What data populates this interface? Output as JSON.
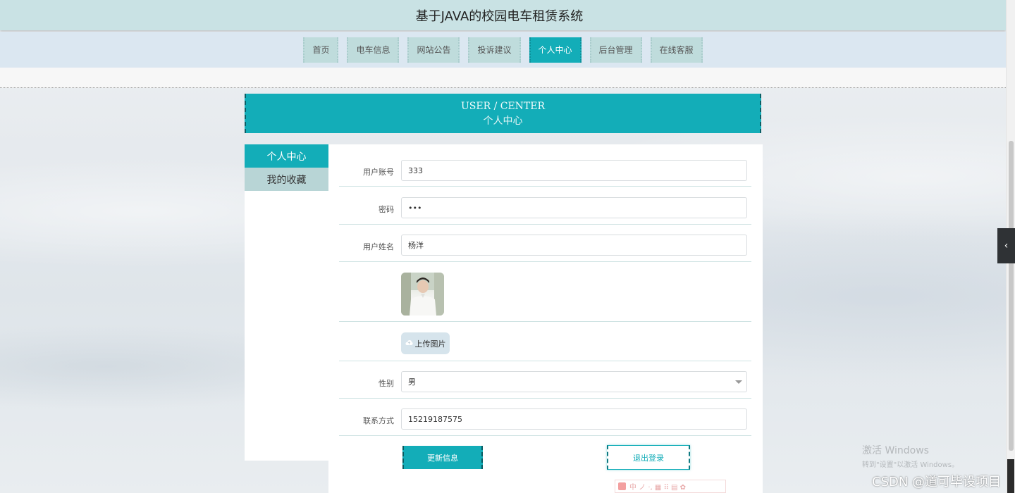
{
  "header": {
    "title": "基于JAVA的校园电车租赁系统"
  },
  "nav": {
    "items": [
      {
        "label": "首页",
        "active": false
      },
      {
        "label": "电车信息",
        "active": false
      },
      {
        "label": "网站公告",
        "active": false
      },
      {
        "label": "投诉建议",
        "active": false
      },
      {
        "label": "个人中心",
        "active": true
      },
      {
        "label": "后台管理",
        "active": false
      },
      {
        "label": "在线客服",
        "active": false
      }
    ]
  },
  "banner": {
    "title_en": "USER / CENTER",
    "title_cn": "个人中心"
  },
  "sidebar": {
    "items": [
      {
        "label": "个人中心",
        "active": true
      },
      {
        "label": "我的收藏",
        "active": false
      }
    ]
  },
  "form": {
    "account": {
      "label": "用户账号",
      "value": "333"
    },
    "password": {
      "label": "密码",
      "value": "•••"
    },
    "name": {
      "label": "用户姓名",
      "value": "杨洋"
    },
    "upload_label": "上传图片",
    "gender": {
      "label": "性别",
      "value": "男"
    },
    "contact": {
      "label": "联系方式",
      "value": "15219187575"
    },
    "update_label": "更新信息",
    "logout_label": "退出登录"
  },
  "ime": {
    "text": "中 ノ ·, ▦ ⠿ ▤ ✿"
  },
  "watermarks": {
    "windows_line1": "激活 Windows",
    "windows_line2": "转到\"设置\"以激活 Windows。",
    "csdn": "CSDN @道可毕设项目"
  },
  "icons": {
    "upload": "cloud-upload-icon",
    "toggle": "chevron-left-icon"
  },
  "colors": {
    "accent": "#13adb8",
    "header_bg": "#c9e2e4",
    "nav_bg": "#dbe7f1",
    "nav_item_bg": "#bfdcdc"
  }
}
